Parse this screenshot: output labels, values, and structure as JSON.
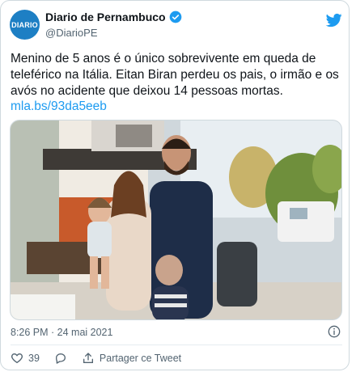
{
  "account": {
    "avatar_text": "DIARIO",
    "display_name": "Diario de Pernambuco",
    "handle": "@DiarioPE"
  },
  "tweet": {
    "text": "Menino de 5 anos é o único sobrevivente em queda de teleférico na Itália. Eitan Biran perdeu os pais, o irmão e os avós no acidente que deixou 14 pessoas mortas.",
    "link": "mla.bs/93da5eeb",
    "timestamp": "8:26 PM · 24 mai 2021"
  },
  "actions": {
    "like_count": "39",
    "share_label": "Partager ce Tweet"
  },
  "colors": {
    "accent": "#1d9bf0",
    "avatar_bg": "#1d7fc4",
    "muted_text": "#536471"
  },
  "icons": [
    "verified-badge-icon",
    "twitter-bird-icon",
    "info-icon",
    "heart-icon",
    "reply-icon",
    "share-icon"
  ]
}
